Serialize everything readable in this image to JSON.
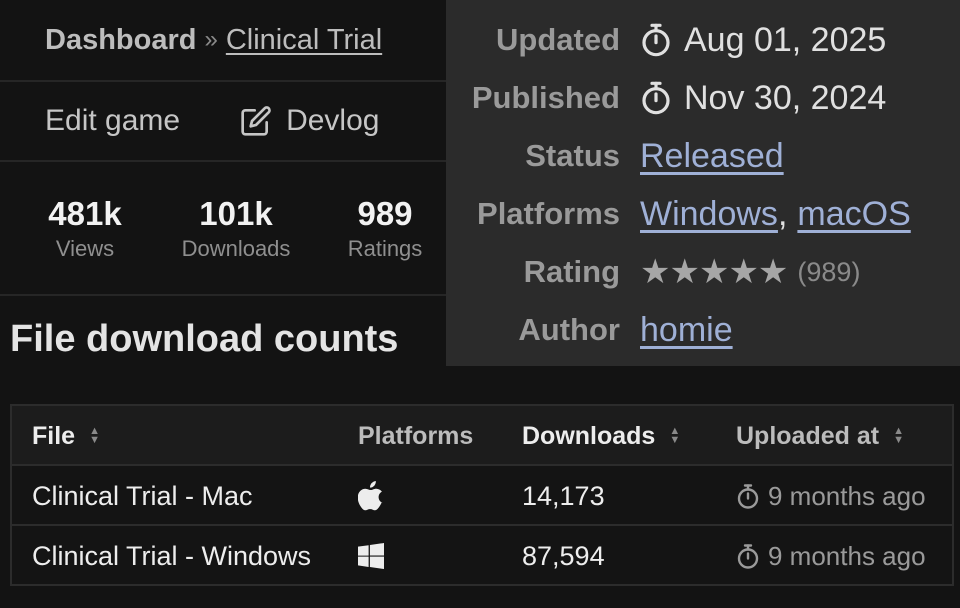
{
  "breadcrumb": {
    "home": "Dashboard",
    "separator": "»",
    "current": "Clinical Trial"
  },
  "actions": {
    "edit": "Edit game",
    "devlog": "Devlog"
  },
  "stats": [
    {
      "value": "481k",
      "label": "Views"
    },
    {
      "value": "101k",
      "label": "Downloads"
    },
    {
      "value": "989",
      "label": "Ratings"
    }
  ],
  "info": {
    "updated": {
      "label": "Updated",
      "value": "Aug 01, 2025"
    },
    "published": {
      "label": "Published",
      "value": "Nov 30, 2024"
    },
    "status": {
      "label": "Status",
      "value": "Released"
    },
    "platforms": {
      "label": "Platforms",
      "windows": "Windows",
      "comma": ",",
      "mac": "macOS"
    },
    "rating": {
      "label": "Rating",
      "stars": "★★★★★",
      "count": "(989)",
      "score": 5
    },
    "author": {
      "label": "Author",
      "value": "homie"
    }
  },
  "downloads": {
    "title": "File download counts",
    "columns": {
      "file": "File",
      "platforms": "Platforms",
      "downloads": "Downloads",
      "uploaded": "Uploaded at"
    },
    "rows": [
      {
        "file": "Clinical Trial - Mac",
        "platform_icon": "apple-icon",
        "downloads": "14,173",
        "uploaded": "9 months ago"
      },
      {
        "file": "Clinical Trial - Windows",
        "platform_icon": "windows-icon",
        "downloads": "87,594",
        "uploaded": "9 months ago"
      }
    ]
  },
  "colors": {
    "link": "#9fb0d6",
    "panel": "#2b2b2b",
    "background": "#131313"
  }
}
